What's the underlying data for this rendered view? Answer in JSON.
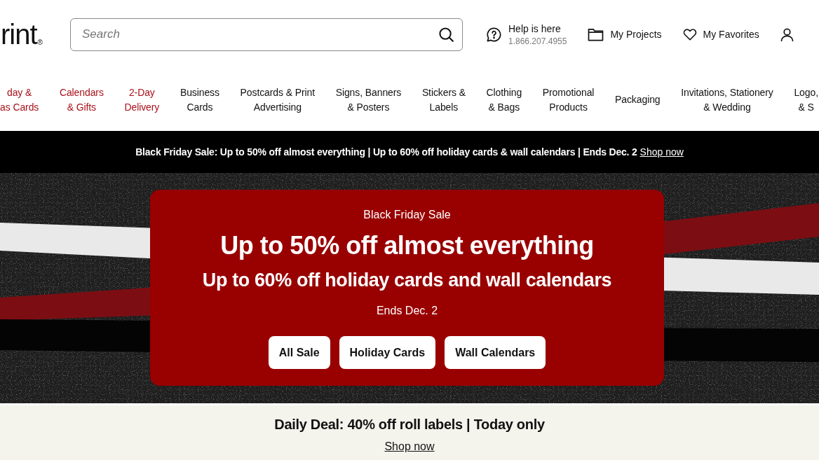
{
  "header": {
    "logo": {
      "text": "rint",
      "mark": "®"
    },
    "search": {
      "placeholder": "Search"
    },
    "links": [
      {
        "kind": "help",
        "label": "Help is here",
        "detail": "1.866.207.4955"
      },
      {
        "kind": "projects",
        "label": "My Projects"
      },
      {
        "kind": "favorites",
        "label": "My Favorites"
      },
      {
        "kind": "account"
      }
    ]
  },
  "nav": {
    "items": [
      {
        "lines": [
          "day &",
          "as Cards"
        ],
        "highlighted": true
      },
      {
        "lines": [
          "Calendars",
          "& Gifts"
        ],
        "highlighted": true
      },
      {
        "lines": [
          "2-Day",
          "Delivery"
        ],
        "highlighted": true
      },
      {
        "lines": [
          "Business",
          "Cards"
        ],
        "highlighted": false
      },
      {
        "lines": [
          "Postcards & Print",
          "Advertising"
        ],
        "highlighted": false
      },
      {
        "lines": [
          "Signs, Banners",
          "& Posters"
        ],
        "highlighted": false
      },
      {
        "lines": [
          "Stickers &",
          "Labels"
        ],
        "highlighted": false
      },
      {
        "lines": [
          "Clothing",
          "& Bags"
        ],
        "highlighted": false
      },
      {
        "lines": [
          "Promotional",
          "Products"
        ],
        "highlighted": false
      },
      {
        "lines": [
          "Packaging"
        ],
        "highlighted": false
      },
      {
        "lines": [
          "Invitations, Stationery",
          "& Wedding"
        ],
        "highlighted": false
      },
      {
        "lines": [
          "Logo,",
          "& S"
        ],
        "highlighted": false
      }
    ]
  },
  "promo_bar": {
    "text": "Black Friday Sale: Up to 50% off almost everything | Up to 60% off holiday cards & wall calendars | Ends Dec. 2",
    "link": "Shop now"
  },
  "hero": {
    "card": {
      "eyebrow": "Black Friday Sale",
      "headline": "Up to 50% off almost everything",
      "subheadline": "Up to 60% off holiday cards and wall calendars",
      "note": "Ends Dec. 2",
      "buttons": [
        "All Sale",
        "Holiday Cards",
        "Wall Calendars"
      ]
    }
  },
  "daily_deal": {
    "text": "Daily Deal: 40% off roll labels | Today only",
    "link": "Shop now"
  }
}
